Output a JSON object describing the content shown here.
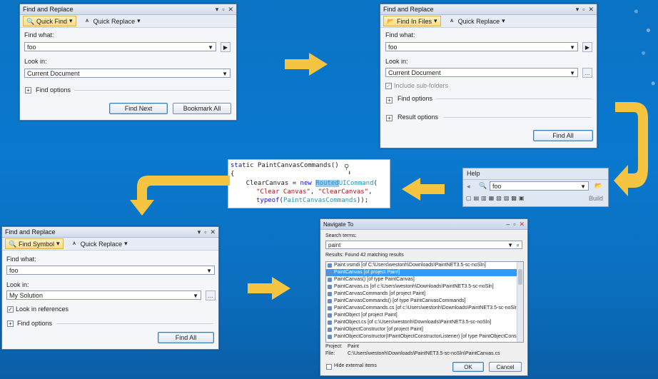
{
  "colors": {
    "background": "#0b73c4",
    "arrow": "#f5c542"
  },
  "w1": {
    "title": "Find and Replace",
    "mode_find": "Quick Find",
    "mode_replace": "Quick Replace",
    "find_label": "Find what:",
    "find_value": "foo",
    "look_label": "Look in:",
    "look_value": "Current Document",
    "options_label": "Find options",
    "btn_next": "Find Next",
    "btn_bookmark": "Bookmark All"
  },
  "w2": {
    "title": "Find and Replace",
    "mode_find": "Find In Files",
    "mode_replace": "Quick Replace",
    "find_label": "Find what:",
    "find_value": "foo",
    "look_label": "Look in:",
    "look_value": "Current Document",
    "browse": "...",
    "subfolders": "Include sub-folders",
    "options_label": "Find options",
    "result_label": "Result options",
    "btn_findall": "Find All"
  },
  "help": {
    "menu": "Help",
    "search_value": "foo",
    "build": "Build"
  },
  "code": {
    "l1_kw": "static",
    "l1_rest": " PaintCanvasCommands()",
    "l2": "{",
    "l3_a": "    ClearCanvas = ",
    "l3_kw": "new",
    "l3_sp": " ",
    "l3_hl": "Routed",
    "l3_typ": "UICommand",
    "l3_end": "(",
    "l4": "\"Clear Canvas\"",
    "l4_c": ", ",
    "l4_b": "\"ClearCanvas\"",
    "l4_e": ",",
    "l5_kw": "typeof",
    "l5_o": "(",
    "l5_typ": "PaintCanvasCommands",
    "l5_e": "));"
  },
  "w3": {
    "title": "Find and Replace",
    "mode_find": "Find Symbol",
    "mode_replace": "Quick Replace",
    "find_label": "Find what:",
    "find_value": "foo",
    "look_label": "Look in:",
    "look_value": "My Solution",
    "browse": "...",
    "refs": "Look in references",
    "options_label": "Find options",
    "btn_findall": "Find All"
  },
  "nav": {
    "title": "Navigate To",
    "search_label": "Search terms:",
    "search_value": "paint",
    "results_label": "Results: Found 42 matching results",
    "rows": [
      "Paint.vsmdi [of C:\\Users\\westonh\\Downloads\\PaintNET3.5-sc-noSln]",
      "PaintCanvas [of project Paint]",
      "PaintCanvas() [of type PaintCanvas]",
      "PaintCanvas.cs [of c:\\Users\\westonh\\Downloads\\PaintNET3.5-sc-noSln]",
      "PaintCanvasCommands [of project Paint]",
      "PaintCanvasCommands() [of type PaintCanvasCommands]",
      "PaintCanvasCommands.cs [of c:\\Users\\westonh\\Downloads\\PaintNET3.5-sc-noSln]",
      "PaintObject [of project Paint]",
      "PaintObject.cs [of c:\\Users\\westonh\\Downloads\\PaintNET3.5-sc-noSln]",
      "PaintObjectConstructor [of project Paint]",
      "PaintObjectConstructor(IPaintObjectConstructorListener) [of type PaintObjectConstr..."
    ],
    "project_label": "Project:",
    "project_value": "Paint",
    "file_label": "File:",
    "file_value": "C:\\Users\\westonh\\Downloads\\PaintNET3.5-sc-noSln\\PaintCanvas.cs",
    "hide_external": "Hide external items",
    "btn_ok": "OK",
    "btn_cancel": "Cancel"
  }
}
